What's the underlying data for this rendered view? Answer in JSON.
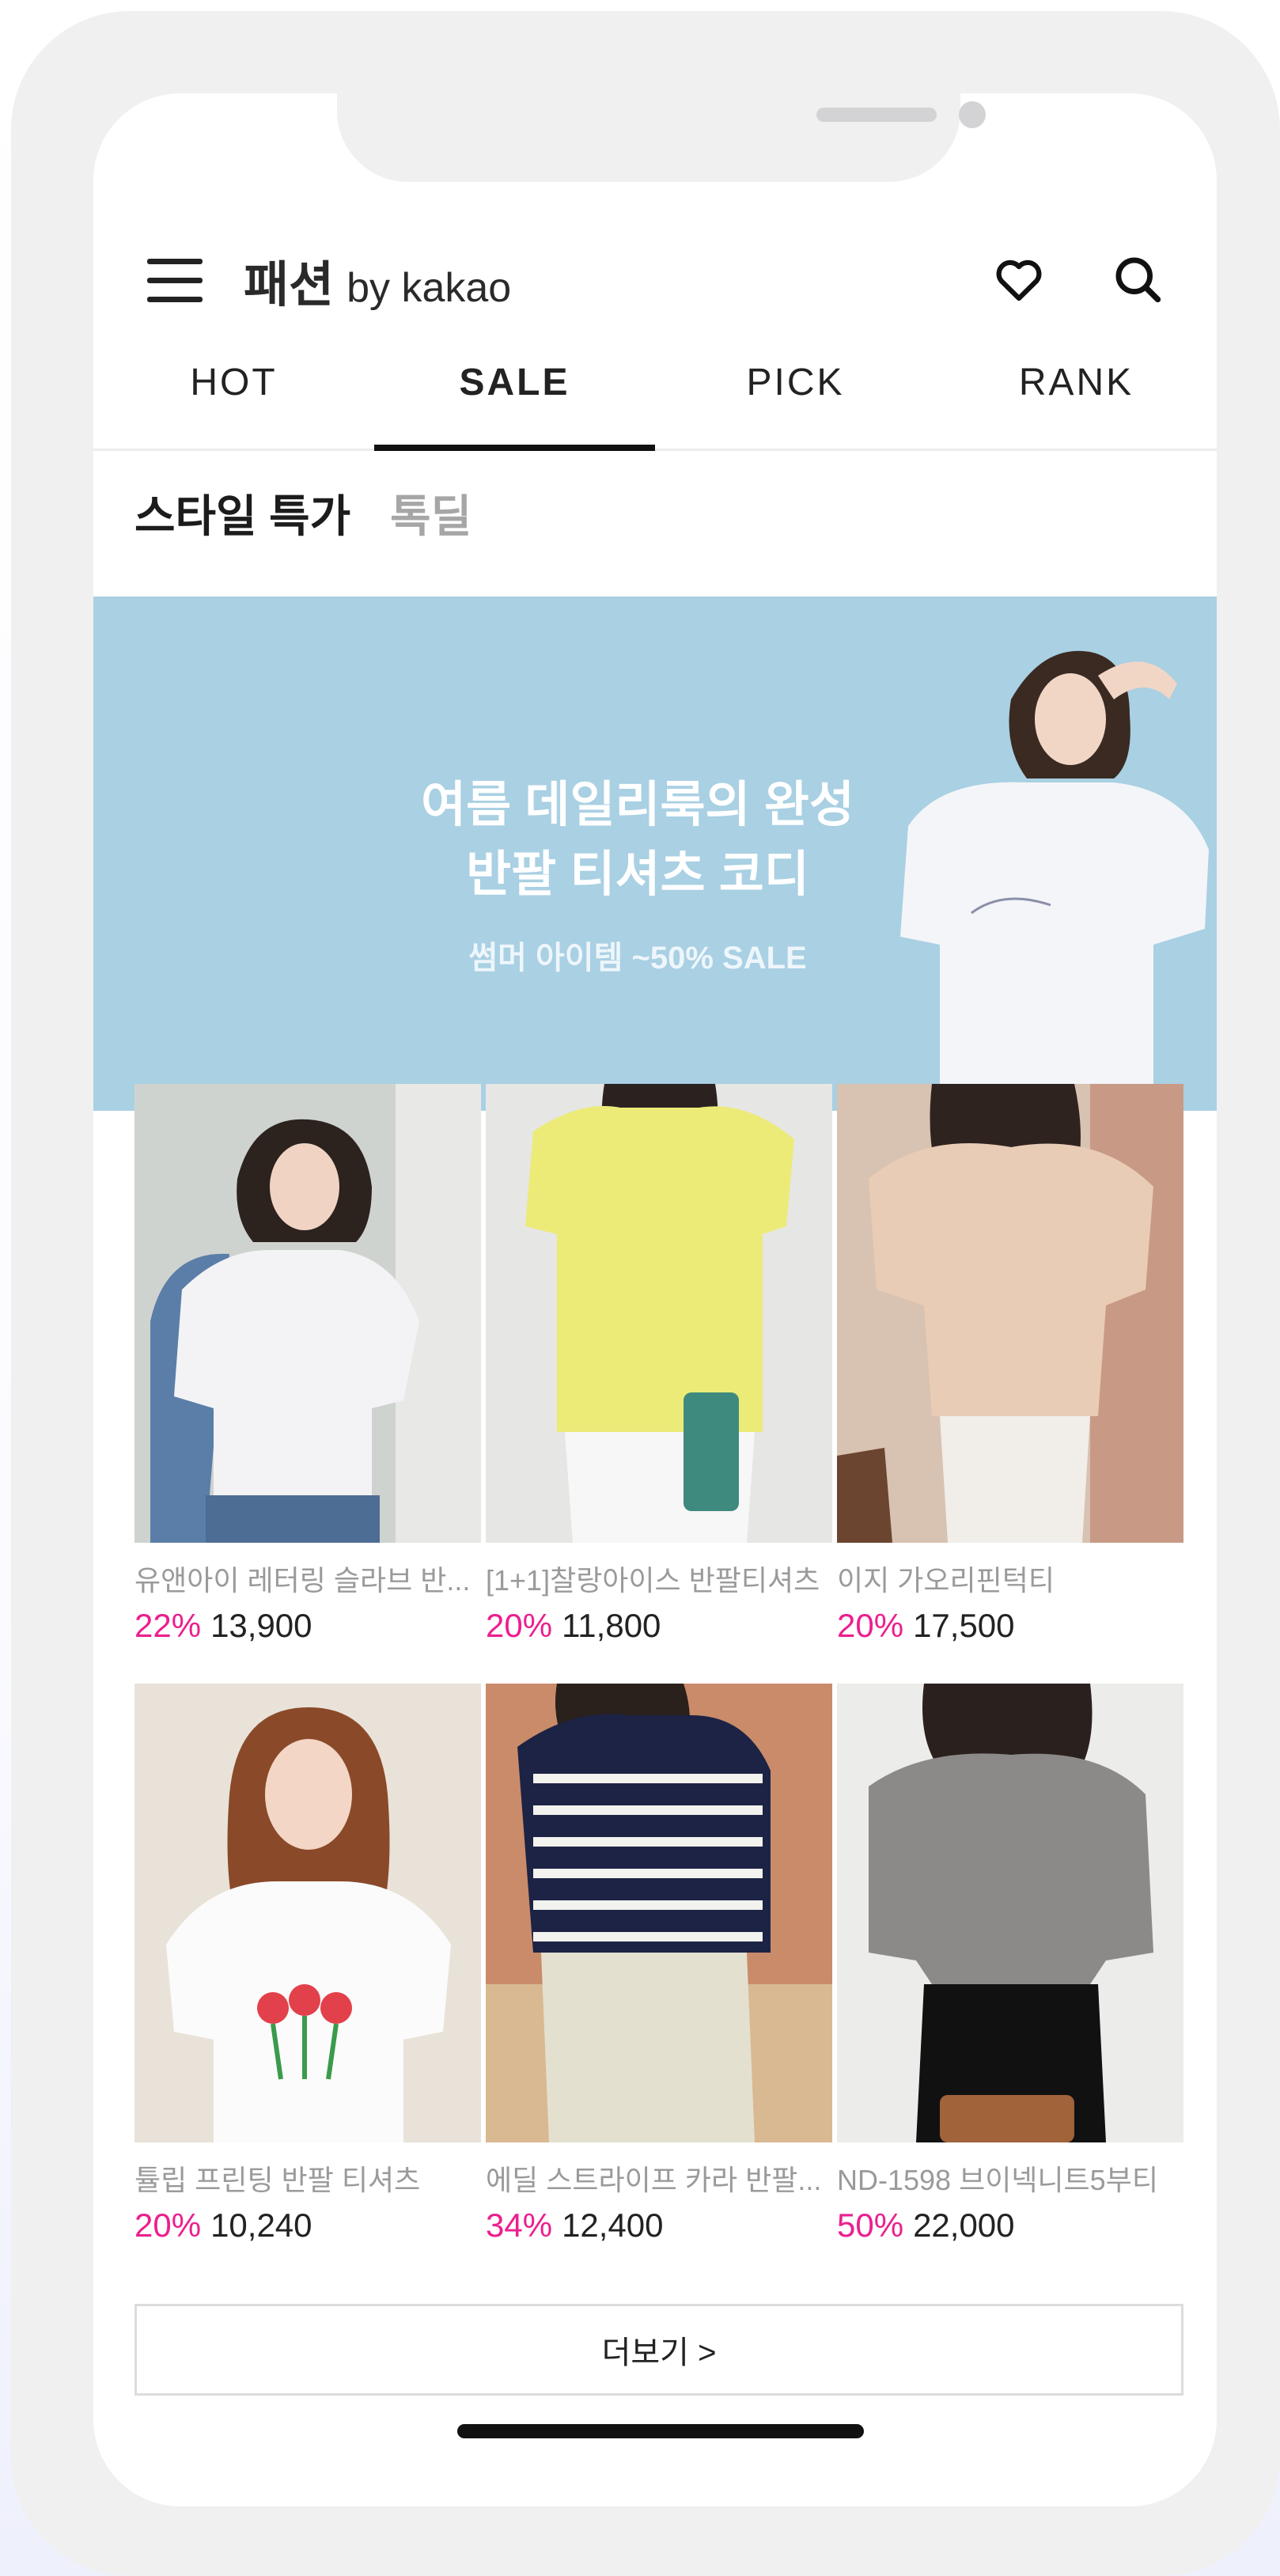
{
  "header": {
    "logo_main": "패션",
    "logo_sub": "by kakao",
    "icons": [
      "menu-icon",
      "heart-icon",
      "search-icon"
    ]
  },
  "tabs": [
    {
      "label": "HOT",
      "active": false
    },
    {
      "label": "SALE",
      "active": true
    },
    {
      "label": "PICK",
      "active": false
    },
    {
      "label": "RANK",
      "active": false
    }
  ],
  "subtabs": [
    {
      "label": "스타일 특가",
      "active": true
    },
    {
      "label": "톡딜",
      "active": false
    }
  ],
  "banner": {
    "title_line1": "여름 데일리룩의 완성",
    "title_line2": "반팔 티셔츠 코디",
    "subtitle": "썸머 아이템 ~50% SALE",
    "bg_color": "#a9d0e3"
  },
  "products": [
    {
      "name": "유앤아이 레터링 슬라브 반...",
      "discount": "22%",
      "price": "13,900"
    },
    {
      "name": "[1+1]찰랑아이스 반팔티셔츠",
      "discount": "20%",
      "price": "11,800"
    },
    {
      "name": "이지 가오리핀턱티",
      "discount": "20%",
      "price": "17,500"
    },
    {
      "name": "튤립 프린팅 반팔 티셔츠",
      "discount": "20%",
      "price": "10,240"
    },
    {
      "name": "에딜 스트라이프 카라 반팔...",
      "discount": "34%",
      "price": "12,400"
    },
    {
      "name": "ND-1598 브이넥니트5부티",
      "discount": "50%",
      "price": "22,000"
    }
  ],
  "more_button": "더보기 >",
  "colors": {
    "discount": "#ec1f8e",
    "accent": "#111111"
  }
}
